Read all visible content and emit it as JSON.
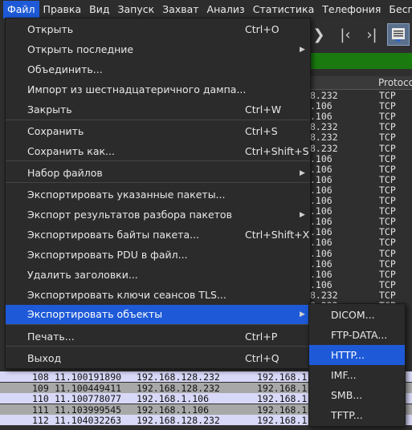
{
  "menubar": {
    "items": [
      "Файл",
      "Правка",
      "Вид",
      "Запуск",
      "Захват",
      "Анализ",
      "Статистика",
      "Телефония",
      "Беспро"
    ]
  },
  "toolbar": {
    "icons": [
      "go-forward-icon",
      "first-packet-icon",
      "last-packet-icon",
      "autoscroll-icon"
    ]
  },
  "packet_list": {
    "header_protocol": "Protoco",
    "rows_top": [
      {
        "addr": "8.232",
        "proto": "TCP"
      },
      {
        "addr": ".106",
        "proto": "TCP"
      },
      {
        "addr": ".106",
        "proto": "TCP"
      },
      {
        "addr": "8.232",
        "proto": "TCP"
      },
      {
        "addr": "8.232",
        "proto": "TCP"
      },
      {
        "addr": "8.232",
        "proto": "TCP"
      },
      {
        "addr": ".106",
        "proto": "TCP"
      },
      {
        "addr": ".106",
        "proto": "TCP"
      },
      {
        "addr": ".106",
        "proto": "TCP"
      },
      {
        "addr": ".106",
        "proto": "TCP"
      },
      {
        "addr": ".106",
        "proto": "TCP"
      },
      {
        "addr": ".106",
        "proto": "TCP"
      },
      {
        "addr": ".106",
        "proto": "TCP"
      },
      {
        "addr": ".106",
        "proto": "TCP"
      },
      {
        "addr": ".106",
        "proto": "TCP"
      },
      {
        "addr": ".106",
        "proto": "TCP"
      },
      {
        "addr": ".106",
        "proto": "TCP"
      },
      {
        "addr": ".106",
        "proto": "TCP"
      },
      {
        "addr": ".106",
        "proto": "TCP"
      },
      {
        "addr": "8.232",
        "proto": "TCP"
      },
      {
        "addr": "8.232",
        "proto": "TCP"
      }
    ],
    "rows_bottom": [
      {
        "no": "108",
        "time": "11.100191890",
        "src": "192.168.128.232",
        "dst": "192.168.1"
      },
      {
        "no": "109",
        "time": "11.100449411",
        "src": "192.168.128.232",
        "dst": "192.168.1"
      },
      {
        "no": "110",
        "time": "11.100778077",
        "src": "192.168.1.106",
        "dst": "192.168.1"
      },
      {
        "no": "111",
        "time": "11.103999545",
        "src": "192.168.1.106",
        "dst": "192.168.1"
      },
      {
        "no": "112",
        "time": "11.104032263",
        "src": "192.168.128.232",
        "dst": "192.168.1"
      }
    ]
  },
  "file_menu": {
    "items": [
      {
        "label": "Открыть",
        "shortcut": "Ctrl+O",
        "submenu": false
      },
      {
        "label": "Открыть последние",
        "shortcut": "",
        "submenu": true
      },
      {
        "label": "Объединить...",
        "shortcut": "",
        "submenu": false
      },
      {
        "label": "Импорт из шестнадцатеричного дампа...",
        "shortcut": "",
        "submenu": false
      },
      {
        "label": "Закрыть",
        "shortcut": "Ctrl+W",
        "submenu": false
      },
      {
        "label": "Сохранить",
        "shortcut": "Ctrl+S",
        "submenu": false
      },
      {
        "label": "Сохранить как...",
        "shortcut": "Ctrl+Shift+S",
        "submenu": false
      },
      {
        "label": "Набор файлов",
        "shortcut": "",
        "submenu": true
      },
      {
        "label": "Экспортировать указанные пакеты...",
        "shortcut": "",
        "submenu": false
      },
      {
        "label": "Экспорт результатов разбора пакетов",
        "shortcut": "",
        "submenu": true
      },
      {
        "label": "Экспортировать байты пакета...",
        "shortcut": "Ctrl+Shift+X",
        "submenu": false
      },
      {
        "label": "Экспортировать PDU в файл...",
        "shortcut": "",
        "submenu": false
      },
      {
        "label": "Удалить заголовки...",
        "shortcut": "",
        "submenu": false
      },
      {
        "label": "Экспортировать ключи сеансов TLS...",
        "shortcut": "",
        "submenu": false
      },
      {
        "label": "Экспортировать объекты",
        "shortcut": "",
        "submenu": true
      },
      {
        "label": "Печать...",
        "shortcut": "Ctrl+P",
        "submenu": false
      },
      {
        "label": "Выход",
        "shortcut": "Ctrl+Q",
        "submenu": false
      }
    ]
  },
  "export_objects_submenu": {
    "items": [
      "DICOM...",
      "FTP-DATA...",
      "HTTP...",
      "IMF...",
      "SMB...",
      "TFTP..."
    ]
  },
  "colors": {
    "accent": "#1e5ad8",
    "filter_ok": "#1a7a10"
  }
}
